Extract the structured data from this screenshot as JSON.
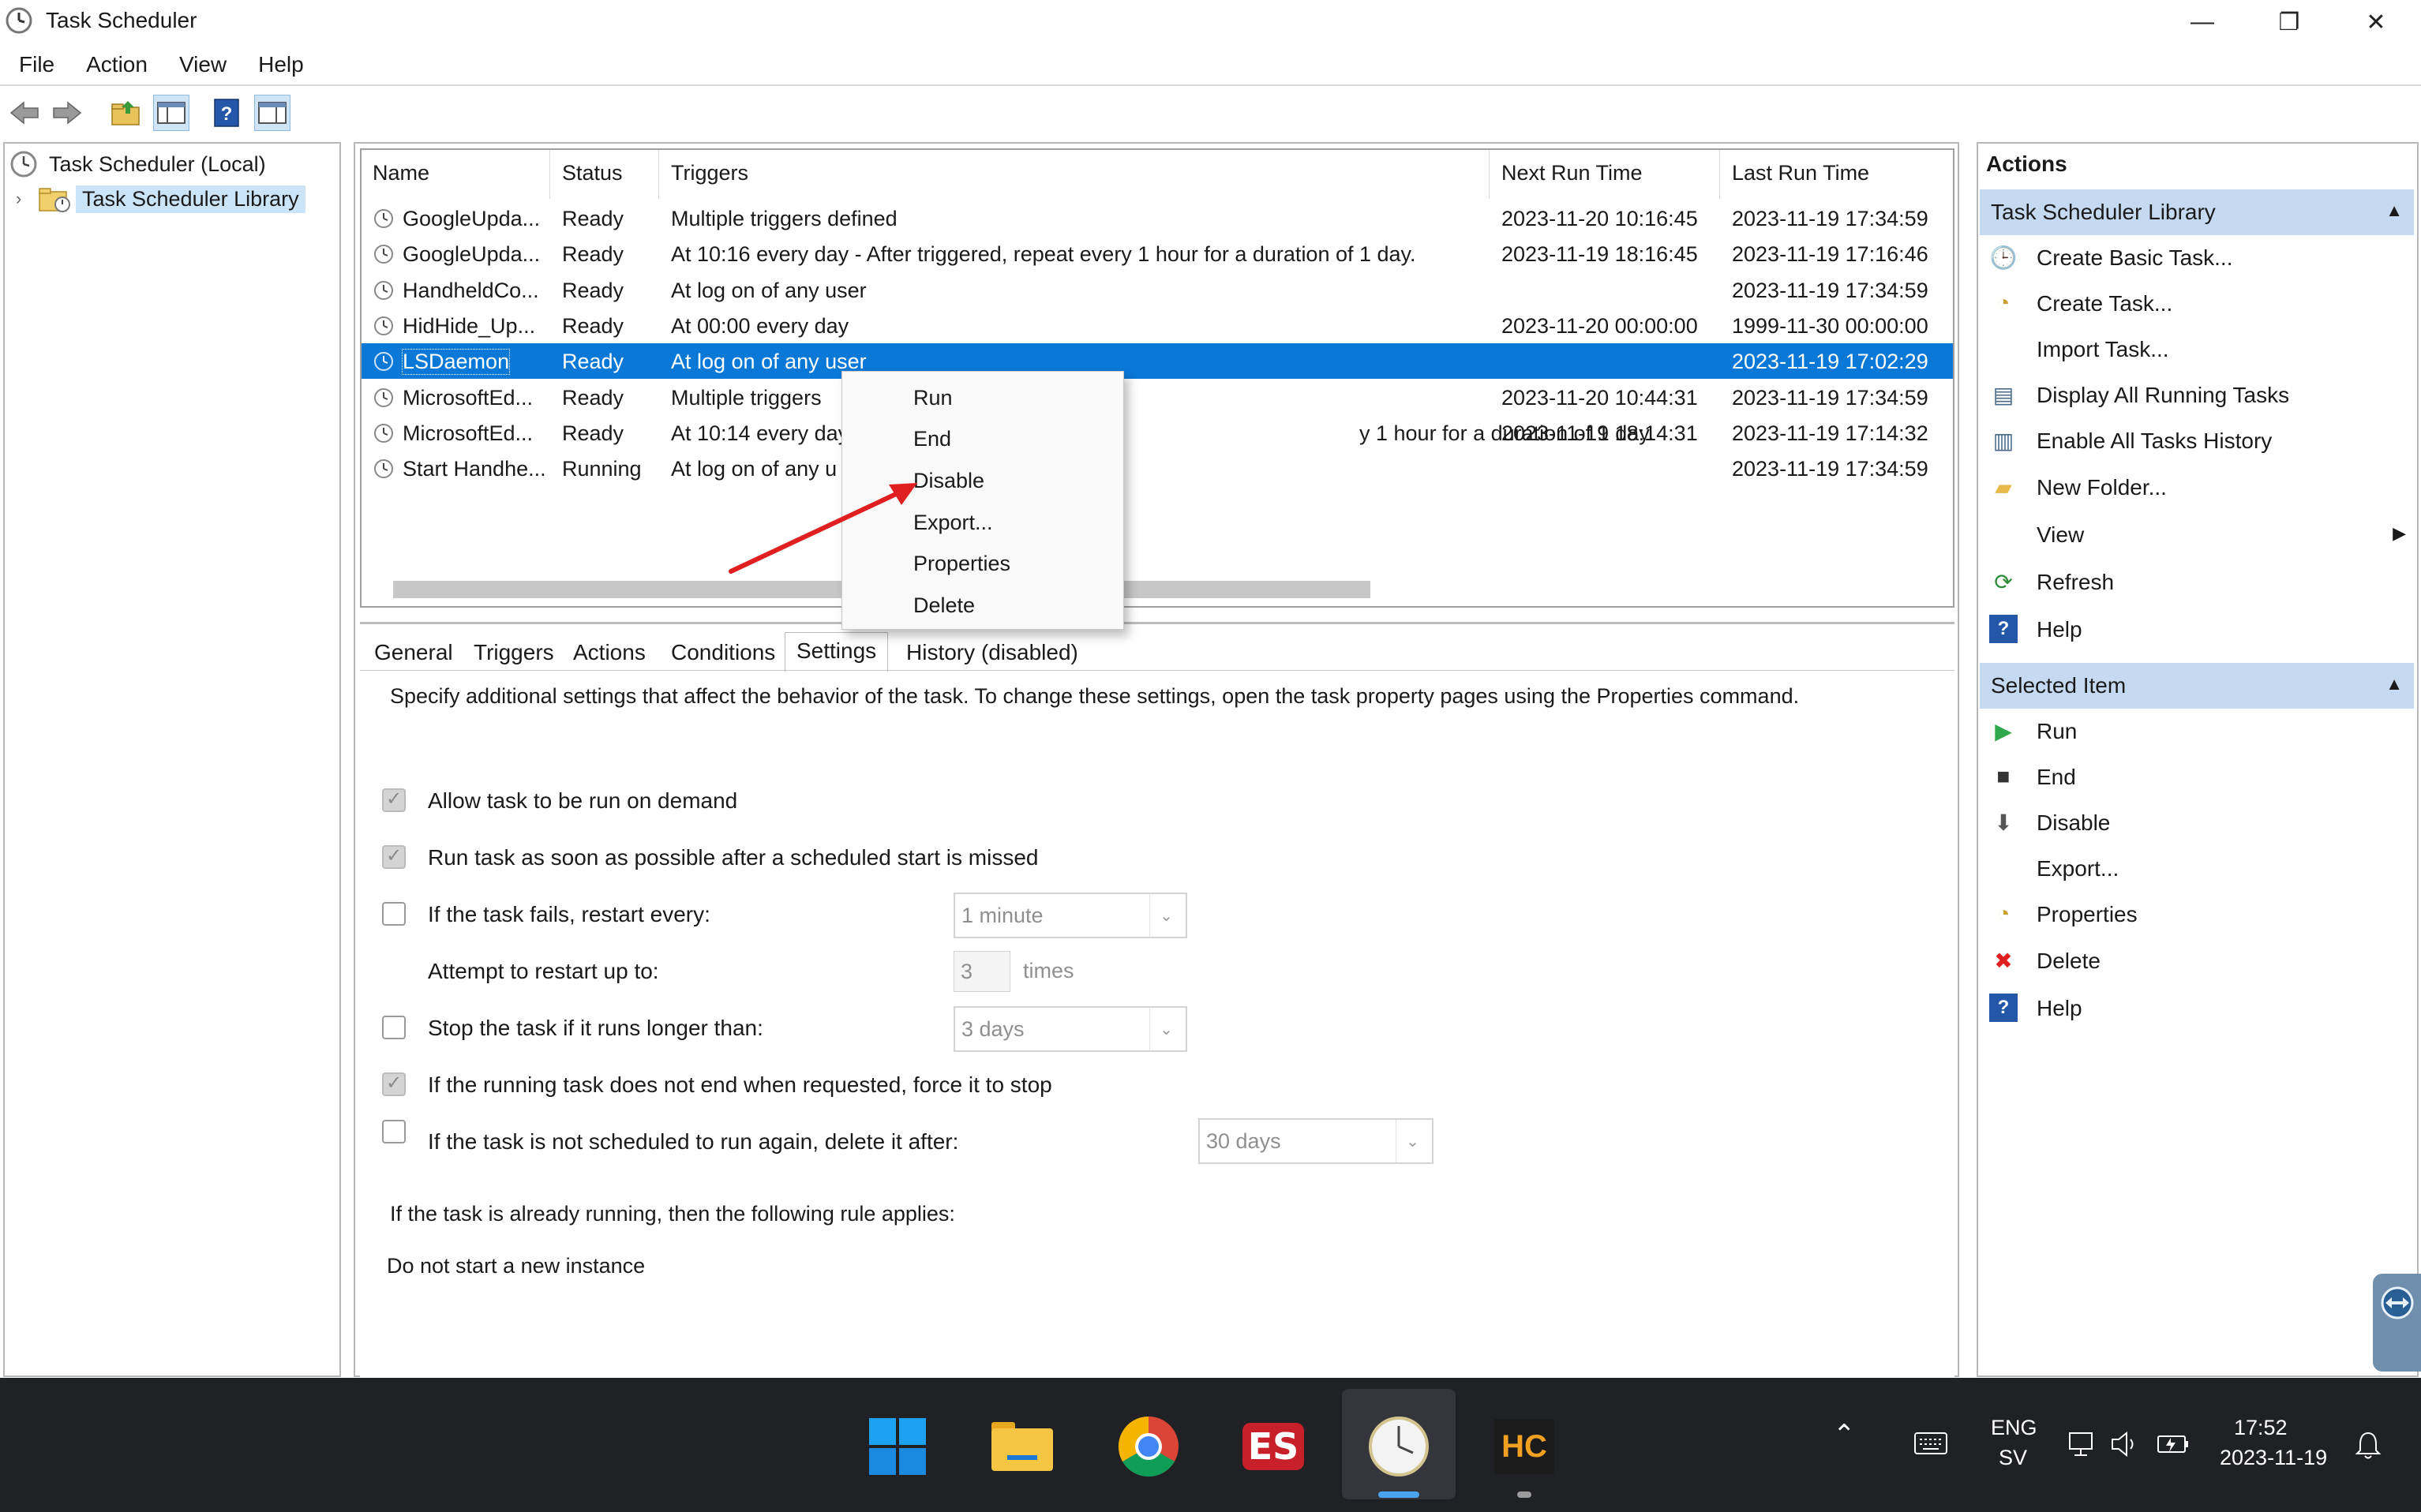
{
  "window": {
    "title": "Task Scheduler",
    "minimize_glyph": "—",
    "restore_glyph": "❐",
    "close_glyph": "✕"
  },
  "menu": [
    "File",
    "Action",
    "View",
    "Help"
  ],
  "tree": {
    "root": "Task Scheduler (Local)",
    "library": "Task Scheduler Library"
  },
  "tasks": {
    "columns": [
      "Name",
      "Status",
      "Triggers",
      "Next Run Time",
      "Last Run Time"
    ],
    "rows": [
      {
        "name": "GoogleUpda...",
        "status": "Ready",
        "triggers": "Multiple triggers defined",
        "next": "2023-11-20 10:16:45",
        "last": "2023-11-19 17:34:59"
      },
      {
        "name": "GoogleUpda...",
        "status": "Ready",
        "triggers": "At 10:16 every day - After triggered, repeat every 1 hour for a duration of 1 day.",
        "next": "2023-11-19 18:16:45",
        "last": "2023-11-19 17:16:46"
      },
      {
        "name": "HandheldCo...",
        "status": "Ready",
        "triggers": "At log on of any user",
        "next": "",
        "last": "2023-11-19 17:34:59"
      },
      {
        "name": "HidHide_Up...",
        "status": "Ready",
        "triggers": "At 00:00 every day",
        "next": "2023-11-20 00:00:00",
        "last": "1999-11-30 00:00:00"
      },
      {
        "name": "LSDaemon",
        "status": "Ready",
        "triggers": "At log on of any user",
        "next": "",
        "last": "2023-11-19 17:02:29"
      },
      {
        "name": "MicrosoftEd...",
        "status": "Ready",
        "triggers": "Multiple triggers",
        "next": "2023-11-20 10:44:31",
        "last": "2023-11-19 17:34:59"
      },
      {
        "name": "MicrosoftEd...",
        "status": "Ready",
        "triggers": "At 10:14 every day",
        "triggers_tail": "y 1 hour for a duration of 1 day.",
        "next": "2023-11-19 18:14:31",
        "last": "2023-11-19 17:14:32"
      },
      {
        "name": "Start Handhe...",
        "status": "Running",
        "triggers": "At log on of any u",
        "next": "",
        "last": "2023-11-19 17:34:59"
      }
    ]
  },
  "context_menu": [
    "Run",
    "End",
    "Disable",
    "Export...",
    "Properties",
    "Delete"
  ],
  "detail": {
    "tabs": [
      "General",
      "Triggers",
      "Actions",
      "Conditions",
      "Settings",
      "History (disabled)"
    ],
    "intro": "Specify additional settings that affect the behavior of the task. To change these settings, open the task property pages using the Properties command.",
    "allow_on_demand": "Allow task to be run on demand",
    "run_asap": "Run task as soon as possible after a scheduled start is missed",
    "restart_every": "If the task fails, restart every:",
    "restart_every_value": "1 minute",
    "attempt_restart": "Attempt to restart up to:",
    "attempt_value": "3",
    "attempt_unit": "times",
    "stop_longer": "Stop the task if it runs longer than:",
    "stop_value": "3 days",
    "force_stop": "If the running task does not end when requested, force it to stop",
    "delete_after": "If the task is not scheduled to run again, delete it after:",
    "delete_value": "30 days",
    "rule_label": "If the task is already running, then the following rule applies:",
    "rule_value": "Do not start a new instance"
  },
  "actions": {
    "title": "Actions",
    "library_header": "Task Scheduler Library",
    "library_items": [
      "Create Basic Task...",
      "Create Task...",
      "Import Task...",
      "Display All Running Tasks",
      "Enable All Tasks History",
      "New Folder...",
      "View",
      "Refresh",
      "Help"
    ],
    "selected_header": "Selected Item",
    "selected_items": [
      "Run",
      "End",
      "Disable",
      "Export...",
      "Properties",
      "Delete",
      "Help"
    ]
  },
  "taskbar": {
    "language": "ENG",
    "layout": "SV",
    "time": "17:52",
    "date": "2023-11-19",
    "hc_label": "HC",
    "es_label": "ES"
  },
  "colors": {
    "selection": "#0a78d7",
    "section_header": "#c5daf0",
    "taskbar": "#202124",
    "arrow": "#e02020"
  }
}
